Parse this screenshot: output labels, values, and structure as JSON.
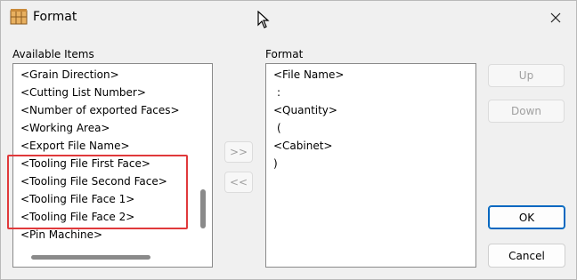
{
  "window": {
    "title": "Format",
    "app_icon": "format-app-icon",
    "close_icon": "close-icon"
  },
  "available": {
    "label": "Available Items",
    "items": [
      "<Grain Direction>",
      "<Cutting List Number>",
      "<Number of exported Faces>",
      "<Working Area>",
      "<Export File Name>",
      "<Tooling File First Face>",
      "<Tooling File Second Face>",
      "<Tooling File Face 1>",
      "<Tooling File Face 2>",
      "<Pin Machine>"
    ]
  },
  "transfer": {
    "add_label": ">>",
    "remove_label": "<<"
  },
  "format": {
    "label": "Format",
    "items": [
      "<File Name>",
      ":",
      "<Quantity>",
      "(",
      "<Cabinet>",
      ")"
    ]
  },
  "buttons": {
    "up_label": "Up",
    "down_label": "Down",
    "ok_label": "OK",
    "cancel_label": "Cancel"
  },
  "colors": {
    "highlight_border": "#e0393b",
    "accent": "#0067c0"
  }
}
